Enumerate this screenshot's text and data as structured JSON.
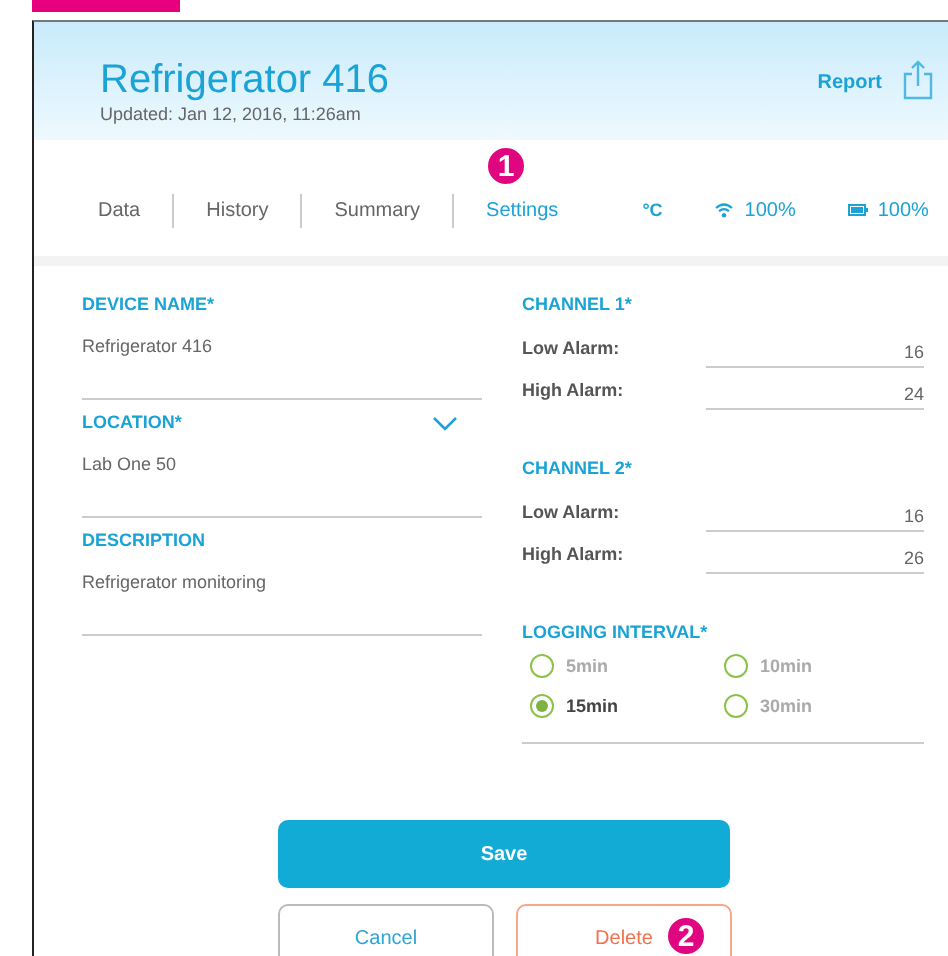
{
  "header": {
    "title": "Refrigerator 416",
    "updated": "Updated: Jan 12, 2016, 11:26am",
    "report": "Report"
  },
  "tabs": [
    {
      "label": "Data",
      "selected": false
    },
    {
      "label": "History",
      "selected": false
    },
    {
      "label": "Summary",
      "selected": false
    },
    {
      "label": "Settings",
      "selected": true
    }
  ],
  "tab_callout": "1",
  "status": {
    "unit": "°C",
    "wifi": "100%",
    "battery": "100%"
  },
  "fields": [
    {
      "label": "DEVICE NAME*",
      "value": "Refrigerator 416",
      "kind": "text"
    },
    {
      "label": "LOCATION*",
      "value": "Lab One 50",
      "kind": "dropdown"
    },
    {
      "label": "DESCRIPTION",
      "value": "Refrigerator monitoring",
      "kind": "text"
    }
  ],
  "channels": [
    {
      "title": "CHANNEL 1*",
      "alarms": [
        {
          "label": "Low Alarm:",
          "value": "16"
        },
        {
          "label": "High Alarm:",
          "value": "24"
        }
      ]
    },
    {
      "title": "CHANNEL 2*",
      "alarms": [
        {
          "label": "Low Alarm:",
          "value": "16"
        },
        {
          "label": "High Alarm:",
          "value": "26"
        }
      ]
    }
  ],
  "logging": {
    "title": "LOGGING INTERVAL*",
    "options": [
      {
        "label": "5min",
        "selected": false
      },
      {
        "label": "10min",
        "selected": false
      },
      {
        "label": "15min",
        "selected": true
      },
      {
        "label": "30min",
        "selected": false
      }
    ]
  },
  "buttons": {
    "save": "Save",
    "cancel": "Cancel",
    "delete": "Delete"
  },
  "delete_callout": "2"
}
